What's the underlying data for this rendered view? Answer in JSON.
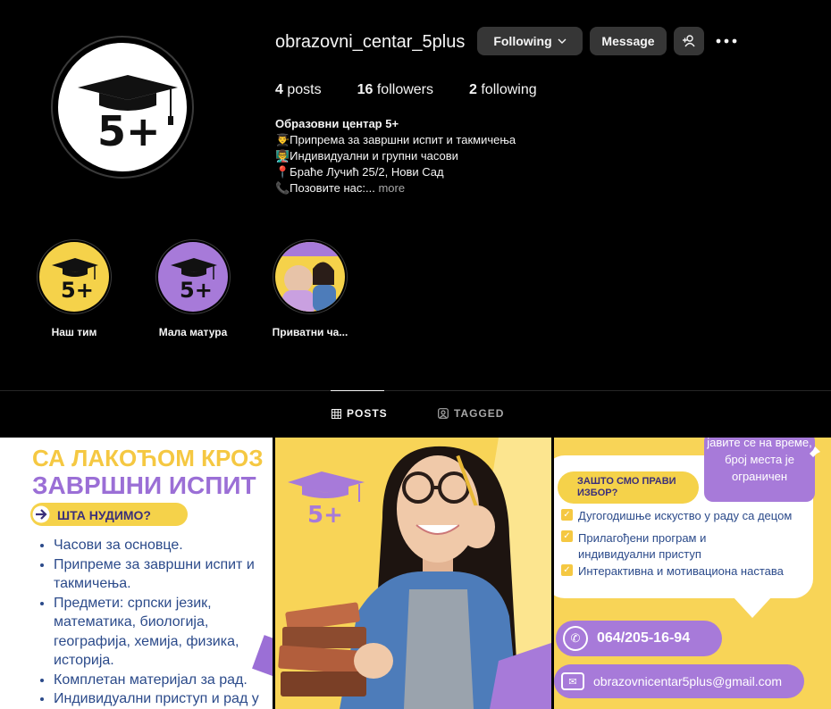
{
  "profile": {
    "username": "obrazovni_centar_5plus",
    "following_label": "Following",
    "message_label": "Message",
    "more_icon": "more-horizontal-icon",
    "add_user_icon": "add-user-icon",
    "stats": {
      "posts_count": "4",
      "posts_label": "posts",
      "followers_count": "16",
      "followers_label": "followers",
      "following_count": "2",
      "following_label": "following"
    },
    "bio": {
      "name": "Образовни центар 5+",
      "line1": "👨‍🎓Припрема за завршни испит и такмичења",
      "line2": "👨‍🏫Индивидуални и групни часови",
      "line3": "📍Браће Лучић 25/2, Нови Сад",
      "line4": "📞Позовите нас:...",
      "more": " more"
    },
    "logo_text": "5+"
  },
  "highlights": [
    {
      "label": "Наш тим",
      "bg": "#f5d24a"
    },
    {
      "label": "Мала матура",
      "bg": "#a77ad9"
    },
    {
      "label": "Приватни ча..."
    }
  ],
  "tabs": {
    "posts": "POSTS",
    "tagged": "TAGGED"
  },
  "posts": {
    "p1": {
      "title1": "СА ЛАКОЋОМ КРОЗ",
      "title2": "ЗАВРШНИ ИСПИТ",
      "pill": "ШТА НУДИМО?",
      "items": [
        "Часови за основце.",
        "Припреме за завршни испит и такмичења.",
        "Предмети: српски језик, математика, биологија, географија, хемија, физика, историја.",
        "Комплетан материјал за рад.",
        "Индивидуални приступ и рад у"
      ]
    },
    "p2": {
      "logo_text": "5+"
    },
    "p3": {
      "note": "јавите се на време, број места је ограничен",
      "pill": "ЗАШТО СМО ПРАВИ ИЗБОР?",
      "items": [
        "Дугогодишње искуство у раду са децом",
        "Прилагођени програм и индивидуални приступ",
        "Интерактивна и мотивациона настава"
      ],
      "phone": "064/205-16-94",
      "email": "obrazovnicentar5plus@gmail.com"
    }
  },
  "colors": {
    "yellow": "#f5d24a",
    "purple": "#a77ad9",
    "button": "#363636",
    "muted": "#a8a8a8"
  }
}
